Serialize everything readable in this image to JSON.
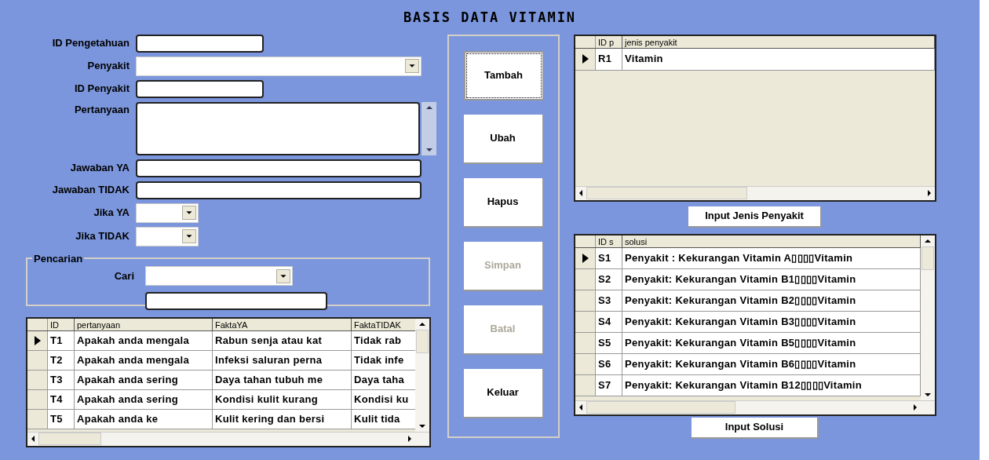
{
  "title": "BASIS DATA VITAMIN",
  "form": {
    "fields": [
      {
        "label": "ID Pengetahuan",
        "kind": "text"
      },
      {
        "label": "Penyakit",
        "kind": "combo"
      },
      {
        "label": "ID Penyakit",
        "kind": "text"
      },
      {
        "label": "Pertanyaan",
        "kind": "textarea"
      },
      {
        "label": "Jawaban YA",
        "kind": "text"
      },
      {
        "label": "Jawaban TIDAK",
        "kind": "text"
      },
      {
        "label": "Jika YA",
        "kind": "combo"
      },
      {
        "label": "Jika TIDAK",
        "kind": "combo"
      }
    ]
  },
  "search": {
    "title": "Pencarian",
    "label": "Cari"
  },
  "question_table": {
    "columns": [
      "ID",
      "pertanyaan",
      "FaktaYA",
      "FaktaTIDAK"
    ],
    "rows": [
      {
        "selected": true,
        "cells": [
          "T1",
          "Apakah anda mengala",
          "Rabun senja atau kat",
          "Tidak rab"
        ]
      },
      {
        "selected": false,
        "cells": [
          "T2",
          "Apakah anda mengala",
          "Infeksi saluran perna",
          "Tidak infe"
        ]
      },
      {
        "selected": false,
        "cells": [
          "T3",
          "Apakah anda sering",
          "Daya tahan tubuh me",
          "Daya taha"
        ]
      },
      {
        "selected": false,
        "cells": [
          "T4",
          "Apakah anda sering",
          "Kondisi kulit kurang",
          "Kondisi ku"
        ]
      },
      {
        "selected": false,
        "cells": [
          "T5",
          "Apakah anda ke",
          "Kulit kering dan bersi",
          "Kulit tida"
        ]
      }
    ]
  },
  "buttons": [
    {
      "label": "Tambah",
      "disabled": false,
      "focused": true
    },
    {
      "label": "Ubah",
      "disabled": false,
      "focused": false
    },
    {
      "label": "Hapus",
      "disabled": false,
      "focused": false
    },
    {
      "label": "Simpan",
      "disabled": true,
      "focused": false
    },
    {
      "label": "Batal",
      "disabled": true,
      "focused": false
    },
    {
      "label": "Keluar",
      "disabled": false,
      "focused": false
    }
  ],
  "disease_table": {
    "columns": [
      "ID p",
      "jenis penyakit"
    ],
    "rows": [
      {
        "selected": true,
        "cells": [
          "R1",
          "Vitamin"
        ]
      }
    ],
    "button": "Input Jenis Penyakit"
  },
  "solution_table": {
    "columns": [
      "ID s",
      "solusi"
    ],
    "rows": [
      {
        "selected": true,
        "cells": [
          "S1",
          "Penyakit : Kekurangan Vitamin A▯▯▯▯Vitamin"
        ]
      },
      {
        "selected": false,
        "cells": [
          "S2",
          "Penyakit: Kekurangan Vitamin B1▯▯▯▯Vitamin"
        ]
      },
      {
        "selected": false,
        "cells": [
          "S3",
          "Penyakit: Kekurangan Vitamin B2▯▯▯▯Vitamin"
        ]
      },
      {
        "selected": false,
        "cells": [
          "S4",
          "Penyakit: Kekurangan Vitamin B3▯▯▯▯Vitamin"
        ]
      },
      {
        "selected": false,
        "cells": [
          "S5",
          "Penyakit: Kekurangan Vitamin B5▯▯▯▯Vitamin"
        ]
      },
      {
        "selected": false,
        "cells": [
          "S6",
          "Penyakit: Kekurangan Vitamin B6▯▯▯▯Vitamin"
        ]
      },
      {
        "selected": false,
        "cells": [
          "S7",
          "Penyakit: Kekurangan Vitamin B12▯▯▯▯Vitamin"
        ]
      }
    ],
    "button": "Input Solusi"
  }
}
